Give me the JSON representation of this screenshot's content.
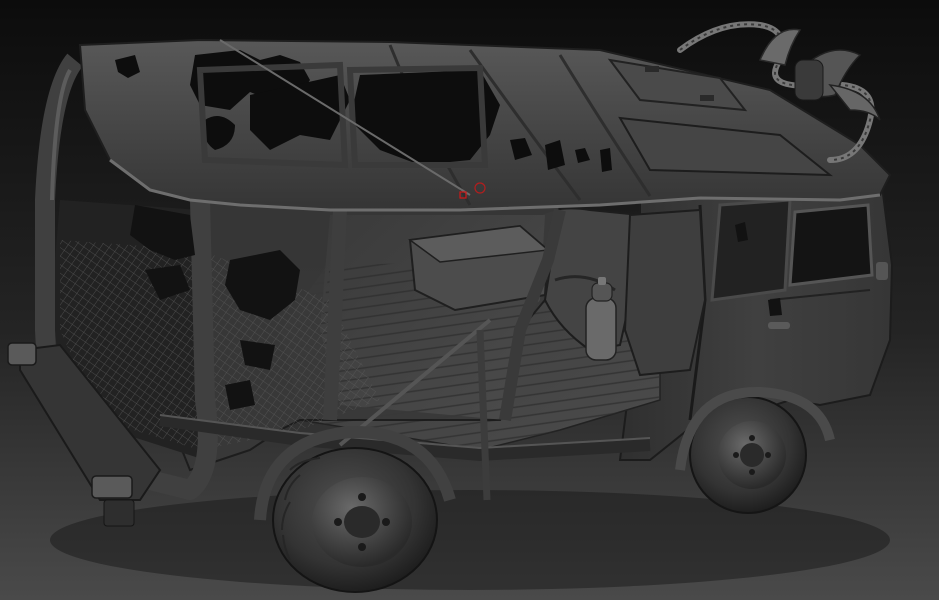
{
  "viewport": {
    "background_top": "#0c0c0c",
    "background_bottom": "#4a4a4a",
    "model_color": "#3c3c3c",
    "model_shadow": "#1e1e1e",
    "model_highlight": "#7a7a7a",
    "tire_color": "#2e2e2e",
    "cursor_color": "#d01818"
  }
}
